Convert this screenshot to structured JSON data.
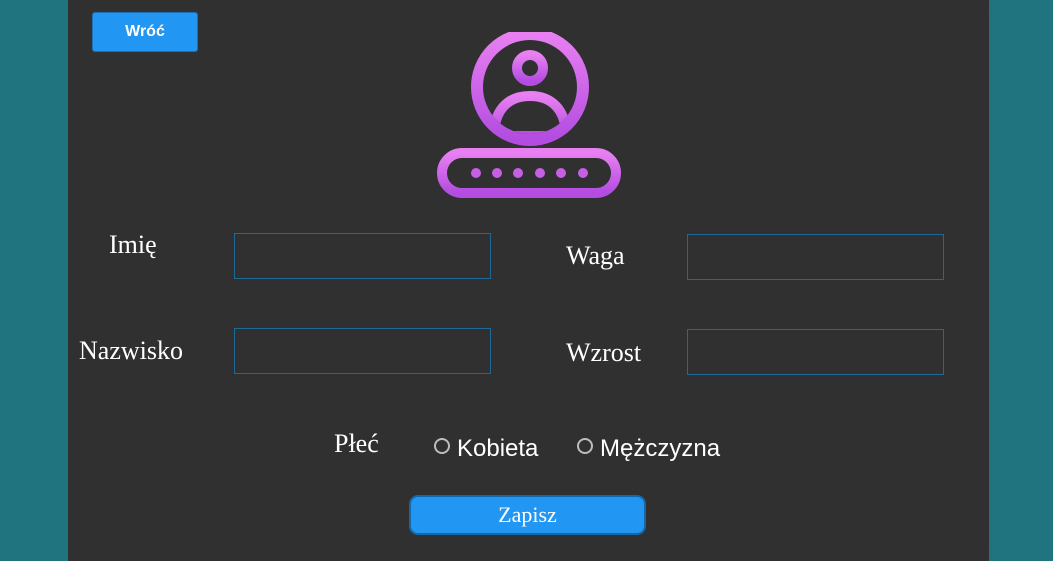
{
  "toolbar": {
    "back_label": "Wróć"
  },
  "logo": {
    "icon": "user-password-icon",
    "gradient_start": "#e880f2",
    "gradient_end": "#b34ce0"
  },
  "form": {
    "first_name": {
      "label": "Imię",
      "value": ""
    },
    "last_name": {
      "label": "Nazwisko",
      "value": ""
    },
    "weight": {
      "label": "Waga",
      "value": ""
    },
    "height": {
      "label": "Wzrost",
      "value": ""
    },
    "gender": {
      "label": "Płeć",
      "options": [
        {
          "label": "Kobieta",
          "selected": false
        },
        {
          "label": "Mężczyzna",
          "selected": false
        }
      ]
    },
    "save_label": "Zapisz"
  },
  "colors": {
    "background": "#1f747f",
    "panel": "#303030",
    "accent": "#2196f3",
    "field_border": "#1c6a9a"
  }
}
